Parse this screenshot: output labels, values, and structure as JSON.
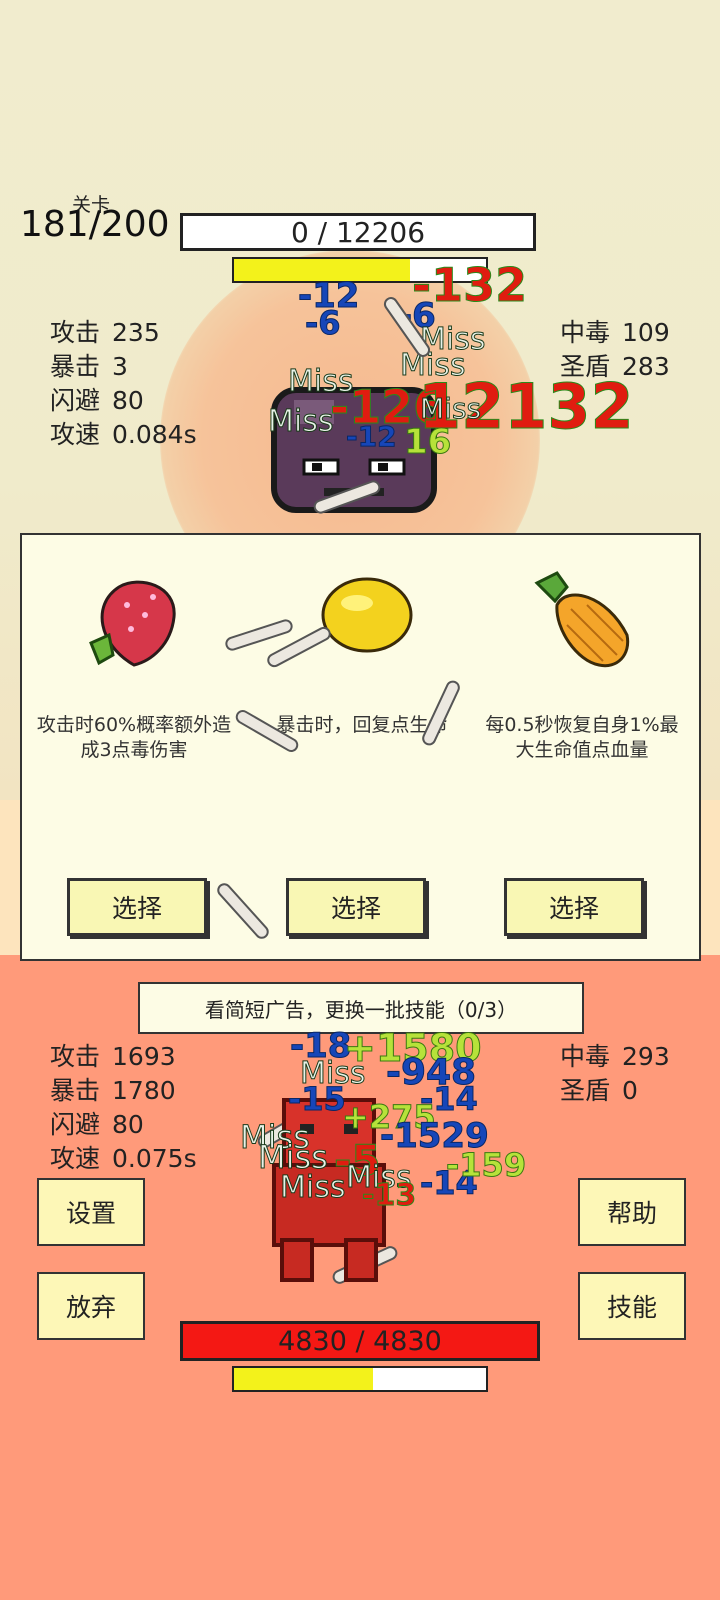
{
  "stage": {
    "label": "关卡",
    "progress": "181/200"
  },
  "enemy": {
    "hp_text": "0 / 12206",
    "charge_fraction": 0.7,
    "stats": [
      {
        "name": "攻击",
        "value": "235"
      },
      {
        "name": "暴击",
        "value": "3"
      },
      {
        "name": "闪避",
        "value": "80"
      },
      {
        "name": "攻速",
        "value": "0.084s"
      }
    ],
    "stats_right": [
      {
        "name": "中毒",
        "value": "109"
      },
      {
        "name": "圣盾",
        "value": "283"
      }
    ],
    "floating": [
      "-12",
      "-6",
      "-132",
      "-6",
      "Miss",
      "Miss",
      "Miss",
      "Miss",
      "-126",
      "12132",
      "-12",
      "16",
      "Miss"
    ]
  },
  "choices": [
    {
      "icon": "strawberry-icon",
      "desc": "攻击时60%概率额外造成3点毒伤害",
      "button": "选择"
    },
    {
      "icon": "lemon-icon",
      "desc": "暴击时，回复点生命",
      "button": "选择"
    },
    {
      "icon": "pineapple-icon",
      "desc": "每0.5秒恢复自身1%最大生命值点血量",
      "button": "选择"
    }
  ],
  "ad_button": "看简短广告，更换一批技能（0/3）",
  "player": {
    "hp_text": "4830 / 4830",
    "charge_fraction": 0.55,
    "stats": [
      {
        "name": "攻击",
        "value": "1693"
      },
      {
        "name": "暴击",
        "value": "1780"
      },
      {
        "name": "闪避",
        "value": "80"
      },
      {
        "name": "攻速",
        "value": "0.075s"
      }
    ],
    "stats_right": [
      {
        "name": "中毒",
        "value": "293"
      },
      {
        "name": "圣盾",
        "value": "0"
      }
    ],
    "floating": [
      "-18",
      "+1580",
      "Miss",
      "-948",
      "-15",
      "-14",
      "+275",
      "Miss",
      "Miss",
      "-1529",
      "-5",
      "Miss",
      "Miss",
      "-14",
      "-159",
      "-13"
    ]
  },
  "buttons": {
    "settings": "设置",
    "help": "帮助",
    "abandon": "放弃",
    "skills": "技能"
  },
  "colors": {
    "enemy_bar": "#ffffff",
    "player_bar": "#f41814",
    "charge": "#f3f21b",
    "bottom_bg": "#ff9a7a"
  }
}
